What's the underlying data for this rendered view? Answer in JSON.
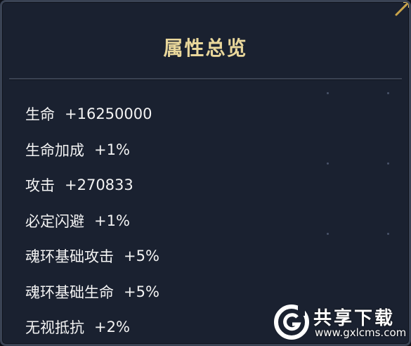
{
  "panel": {
    "title": "属性总览",
    "attributes": [
      {
        "name": "生命",
        "value": "+16250000"
      },
      {
        "name": "生命加成",
        "value": "+1%"
      },
      {
        "name": "攻击",
        "value": "+270833"
      },
      {
        "name": "必定闪避",
        "value": "+1%"
      },
      {
        "name": "魂环基础攻击",
        "value": "+5%"
      },
      {
        "name": "魂环基础生命",
        "value": "+5%"
      },
      {
        "name": "无视抵抗",
        "value": "+2%"
      }
    ]
  },
  "watermark": {
    "name": "共享下载",
    "domain": "www.gxlcms.com"
  },
  "colors": {
    "panel_background": "#1a2130",
    "title": "#e9d79b",
    "text": "#f3f3f3"
  }
}
